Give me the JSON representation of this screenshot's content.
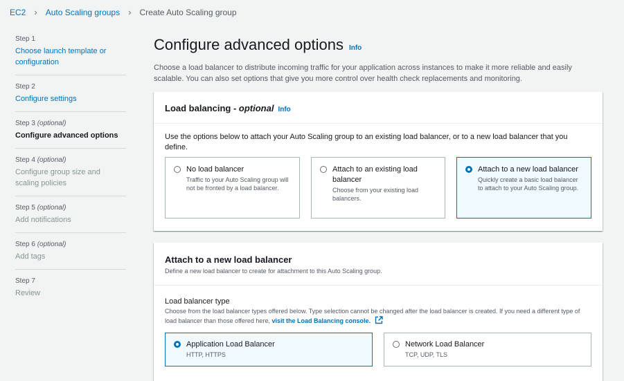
{
  "breadcrumb": {
    "items": [
      "EC2",
      "Auto Scaling groups",
      "Create Auto Scaling group"
    ]
  },
  "steps": [
    {
      "num": "Step 1",
      "optional": "",
      "title": "Choose launch template or configuration",
      "state": "link"
    },
    {
      "num": "Step 2",
      "optional": "",
      "title": "Configure settings",
      "state": "link"
    },
    {
      "num": "Step 3",
      "optional": "(optional)",
      "title": "Configure advanced options",
      "state": "active"
    },
    {
      "num": "Step 4",
      "optional": "(optional)",
      "title": "Configure group size and scaling policies",
      "state": "disabled"
    },
    {
      "num": "Step 5",
      "optional": "(optional)",
      "title": "Add notifications",
      "state": "disabled"
    },
    {
      "num": "Step 6",
      "optional": "(optional)",
      "title": "Add tags",
      "state": "disabled"
    },
    {
      "num": "Step 7",
      "optional": "",
      "title": "Review",
      "state": "disabled"
    }
  ],
  "page": {
    "title": "Configure advanced options",
    "info": "Info",
    "description": "Choose a load balancer to distribute incoming traffic for your application across instances to make it more reliable and easily scalable. You can also set options that give you more control over health check replacements and monitoring."
  },
  "load_balancing": {
    "title": "Load balancing",
    "title_sep": " - ",
    "title_optional": "optional",
    "info": "Info",
    "intro": "Use the options below to attach your Auto Scaling group to an existing load balancer, or to a new load balancer that you define.",
    "options": [
      {
        "label": "No load balancer",
        "desc": "Traffic to your Auto Scaling group will not be fronted by a load balancer.",
        "selected": false
      },
      {
        "label": "Attach to an existing load balancer",
        "desc": "Choose from your existing load balancers.",
        "selected": false
      },
      {
        "label": "Attach to a new load balancer",
        "desc": "Quickly create a basic load balancer to attach to your Auto Scaling group.",
        "selected": true
      }
    ]
  },
  "new_lb": {
    "title": "Attach to a new load balancer",
    "subtitle": "Define a new load balancer to create for attachment to this Auto Scaling group.",
    "type_label": "Load balancer type",
    "type_desc": "Choose from the load balancer types offered below. Type selection cannot be changed after the load balancer is created. If you need a different type of load balancer than those offered here, ",
    "type_link": "visit the Load Balancing console.",
    "types": [
      {
        "label": "Application Load Balancer",
        "desc": "HTTP, HTTPS",
        "selected": true
      },
      {
        "label": "Network Load Balancer",
        "desc": "TCP, UDP, TLS",
        "selected": false
      }
    ]
  },
  "colors": {
    "accent": "#0073bb",
    "selected_bg": "#f1faff",
    "page_bg": "#f2f3f3"
  }
}
